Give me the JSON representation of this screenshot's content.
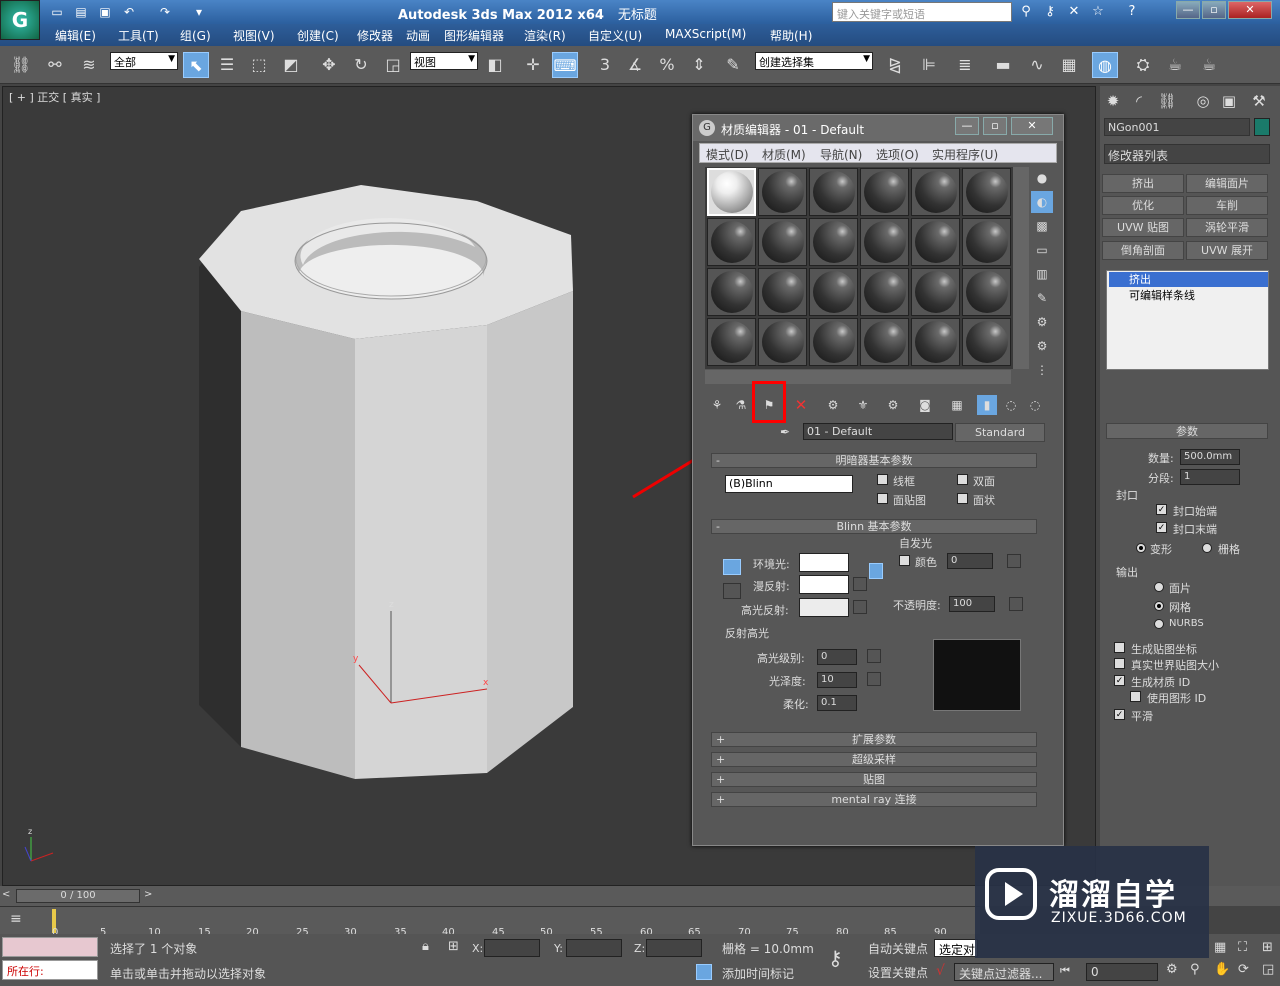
{
  "window": {
    "title": "Autodesk 3ds Max  2012 x64",
    "doc": "无标题",
    "search_placeholder": "键入关键字或短语"
  },
  "menu": [
    "编辑(E)",
    "工具(T)",
    "组(G)",
    "视图(V)",
    "创建(C)",
    "修改器",
    "动画",
    "图形编辑器",
    "渲染(R)",
    "自定义(U)",
    "MAXScript(M)",
    "帮助(H)"
  ],
  "toolbar": {
    "filter": "全部",
    "ref_coord": "视图",
    "named_sel": "创建选择集",
    "snap_label": "3"
  },
  "viewport": {
    "label": "[ + ] 正交 [ 真实 ]",
    "axis_x": "x",
    "axis_y": "y",
    "axis_z": "z"
  },
  "cmd": {
    "object_name": "NGon001",
    "modlist": "修改器列表",
    "mods": [
      "挤出",
      "编辑面片",
      "优化",
      "车削",
      "UVW 贴图",
      "涡轮平滑",
      "倒角剖面",
      "UVW 展开"
    ],
    "stack": [
      "挤出",
      "可编辑样条线"
    ],
    "params_title": "参数",
    "amount_label": "数量:",
    "amount": "500.0mm",
    "segs_label": "分段:",
    "segs": "1",
    "cap_group": "封口",
    "cap_start": "封口始端",
    "cap_end": "封口末端",
    "morph": "变形",
    "grid": "栅格",
    "output_group": "输出",
    "patch": "面片",
    "mesh": "网格",
    "nurbs": "NURBS",
    "gen_map": "生成贴图坐标",
    "real_world": "真实世界贴图大小",
    "gen_matid": "生成材质 ID",
    "use_shape_id": "使用图形 ID",
    "smooth": "平滑"
  },
  "me": {
    "title": "材质编辑器 - 01 - Default",
    "menu": [
      "模式(D)",
      "材质(M)",
      "导航(N)",
      "选项(O)",
      "实用程序(U)"
    ],
    "mat_name": "01 - Default",
    "mat_type": "Standard",
    "shader_roll": "明暗器基本参数",
    "shader": "(B)Blinn",
    "wire": "线框",
    "twosided": "双面",
    "facemap": "面贴图",
    "faceted": "面状",
    "blinn_roll": "Blinn 基本参数",
    "selfillum": "自发光",
    "color": "颜色",
    "selfillum_val": "0",
    "ambient": "环境光:",
    "diffuse": "漫反射:",
    "specular": "高光反射:",
    "opacity_label": "不透明度:",
    "opacity": "100",
    "spec_group": "反射高光",
    "spec_level": "高光级别:",
    "spec_level_val": "0",
    "gloss": "光泽度:",
    "gloss_val": "10",
    "soften": "柔化:",
    "soften_val": "0.1",
    "rolls": [
      "扩展参数",
      "超级采样",
      "贴图",
      "mental ray 连接"
    ]
  },
  "timeline": {
    "frame": "0 / 100",
    "ticks": [
      "0",
      "5",
      "10",
      "15",
      "20",
      "25",
      "30",
      "35",
      "40",
      "45",
      "50",
      "55",
      "60",
      "65",
      "70",
      "75",
      "80",
      "85",
      "90"
    ]
  },
  "status": {
    "running": "所在行:",
    "selected": "选择了 1 个对象",
    "hint": "单击或单击并拖动以选择对象",
    "x": "X:",
    "y": "Y:",
    "z": "Z:",
    "grid": "栅格 = 10.0mm",
    "autokey": "自动关键点",
    "setkey": "设置关键点",
    "selected_dd": "选定对",
    "add_tag": "添加时间标记",
    "key_filter": "关键点过滤器...",
    "frame_val": "0"
  },
  "watermark": {
    "brand": "溜溜自学",
    "url": "ZIXUE.3D66.COM"
  }
}
